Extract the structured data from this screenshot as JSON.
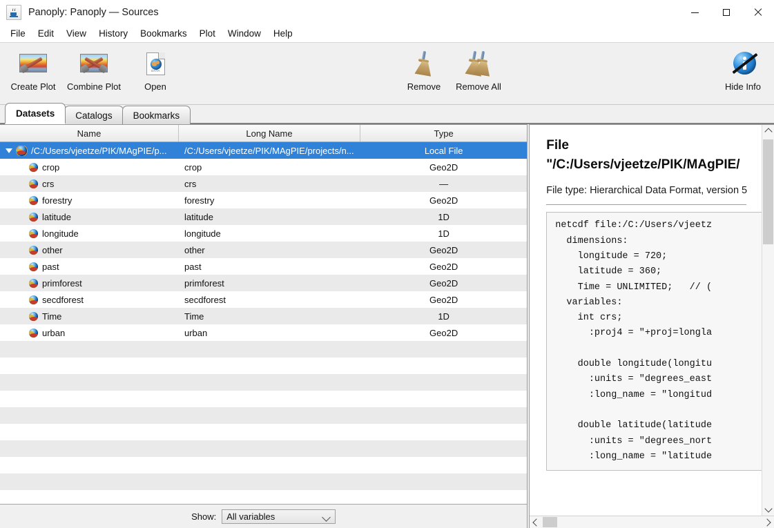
{
  "window": {
    "title": "Panoply: Panoply — Sources",
    "app_icon": "java-cup-icon",
    "minimize": "—",
    "maximize": "□",
    "close": "✕"
  },
  "menu": {
    "items": [
      "File",
      "Edit",
      "View",
      "History",
      "Bookmarks",
      "Plot",
      "Window",
      "Help"
    ]
  },
  "toolbar": {
    "buttons": [
      {
        "label": "Create Plot",
        "icon": "create-plot-icon"
      },
      {
        "label": "Combine Plot",
        "icon": "combine-plot-icon"
      },
      {
        "label": "Open",
        "icon": "open-file-icon"
      },
      {
        "label": "Remove",
        "icon": "broom-icon"
      },
      {
        "label": "Remove All",
        "icon": "broom-all-icon"
      },
      {
        "label": "Hide Info",
        "icon": "hide-info-icon"
      }
    ],
    "doc_icon_caption": "DATA"
  },
  "tabs": [
    {
      "label": "Datasets",
      "active": true
    },
    {
      "label": "Catalogs",
      "active": false
    },
    {
      "label": "Bookmarks",
      "active": false
    }
  ],
  "table": {
    "columns": [
      "Name",
      "Long Name",
      "Type"
    ],
    "rows": [
      {
        "name": "/C:/Users/vjeetze/PIK/MAgPIE/p...",
        "long_name": "/C:/Users/vjeetze/PIK/MAgPIE/projects/n...",
        "type": "Local File",
        "selected": true,
        "root": true
      },
      {
        "name": "crop",
        "long_name": "crop",
        "type": "Geo2D"
      },
      {
        "name": "crs",
        "long_name": "crs",
        "type": "—"
      },
      {
        "name": "forestry",
        "long_name": "forestry",
        "type": "Geo2D"
      },
      {
        "name": "latitude",
        "long_name": "latitude",
        "type": "1D"
      },
      {
        "name": "longitude",
        "long_name": "longitude",
        "type": "1D"
      },
      {
        "name": "other",
        "long_name": "other",
        "type": "Geo2D"
      },
      {
        "name": "past",
        "long_name": "past",
        "type": "Geo2D"
      },
      {
        "name": "primforest",
        "long_name": "primforest",
        "type": "Geo2D"
      },
      {
        "name": "secdforest",
        "long_name": "secdforest",
        "type": "Geo2D"
      },
      {
        "name": "Time",
        "long_name": "Time",
        "type": "1D"
      },
      {
        "name": "urban",
        "long_name": "urban",
        "type": "Geo2D"
      }
    ]
  },
  "show_bar": {
    "label": "Show:",
    "selected": "All variables"
  },
  "info": {
    "heading_line1": "File",
    "heading_line2": "\"/C:/Users/vjeetze/PIK/MAgPIE/",
    "filetype": "File type: Hierarchical Data Format, version 5",
    "cdl": "netcdf file:/C:/Users/vjeetz\n  dimensions:\n    longitude = 720;\n    latitude = 360;\n    Time = UNLIMITED;   // (\n  variables:\n    int crs;\n      :proj4 = \"+proj=longla\n\n    double longitude(longitu\n      :units = \"degrees_east\n      :long_name = \"longitud\n\n    double latitude(latitude\n      :units = \"degrees_nort\n      :long_name = \"latitude"
  },
  "colors": {
    "selection_blue": "#2f82d8",
    "toolbar_bg": "#f0f0f0",
    "row_alt": "#eaeaea",
    "scroll_thumb": "#cdcdcd"
  }
}
